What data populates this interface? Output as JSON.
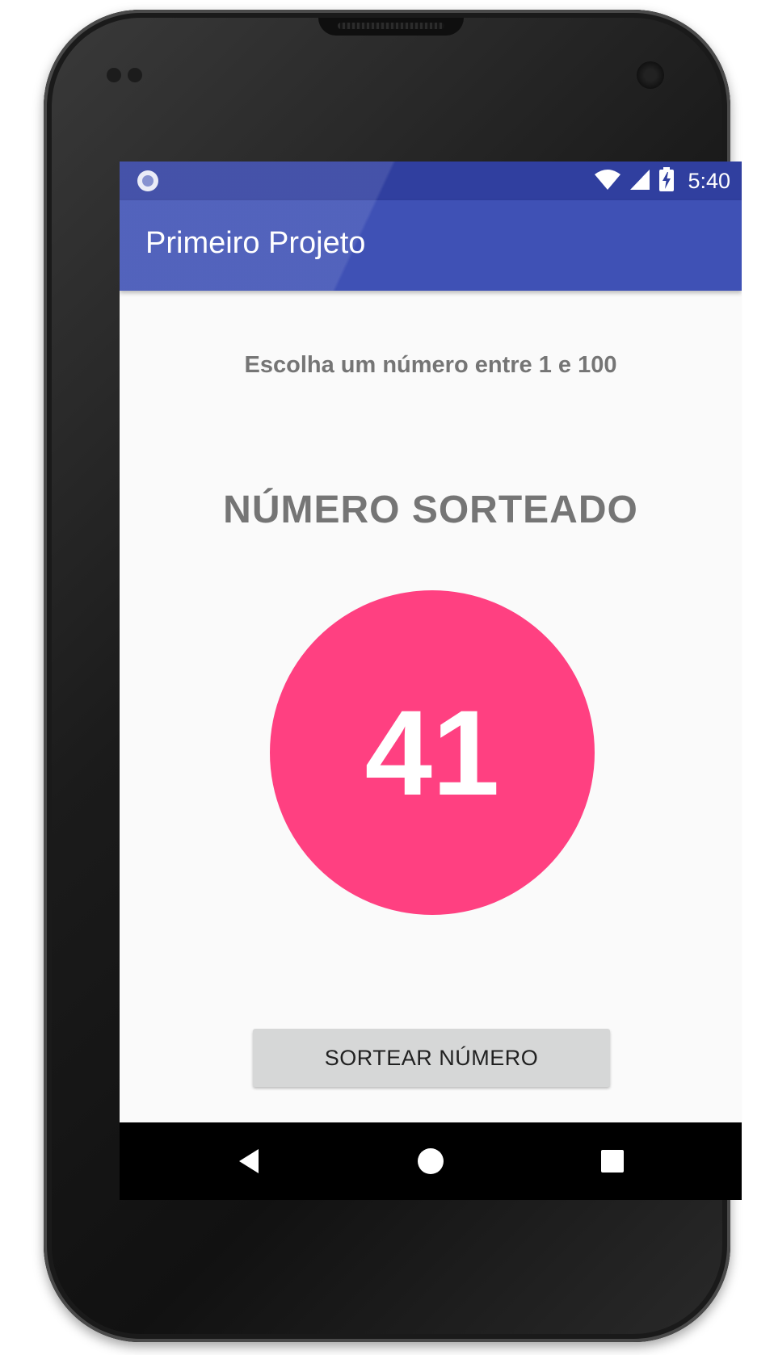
{
  "status_bar": {
    "time": "5:40",
    "icons": [
      "notification-icon",
      "wifi-icon",
      "cell-signal-icon",
      "battery-charging-icon"
    ]
  },
  "app_bar": {
    "title": "Primeiro Projeto"
  },
  "content": {
    "instruction": "Escolha um número entre 1 e 100",
    "result_label": "NÚMERO SORTEADO",
    "drawn_number": "41",
    "button_label": "SORTEAR NÚMERO"
  },
  "nav_bar": {
    "icons": [
      "back-icon",
      "home-icon",
      "recents-icon"
    ]
  },
  "colors": {
    "primary": "#3f51b5",
    "primary_dark": "#303f9f",
    "accent": "#ff4081",
    "text_secondary": "#757575",
    "button_bg": "#d6d7d7"
  }
}
